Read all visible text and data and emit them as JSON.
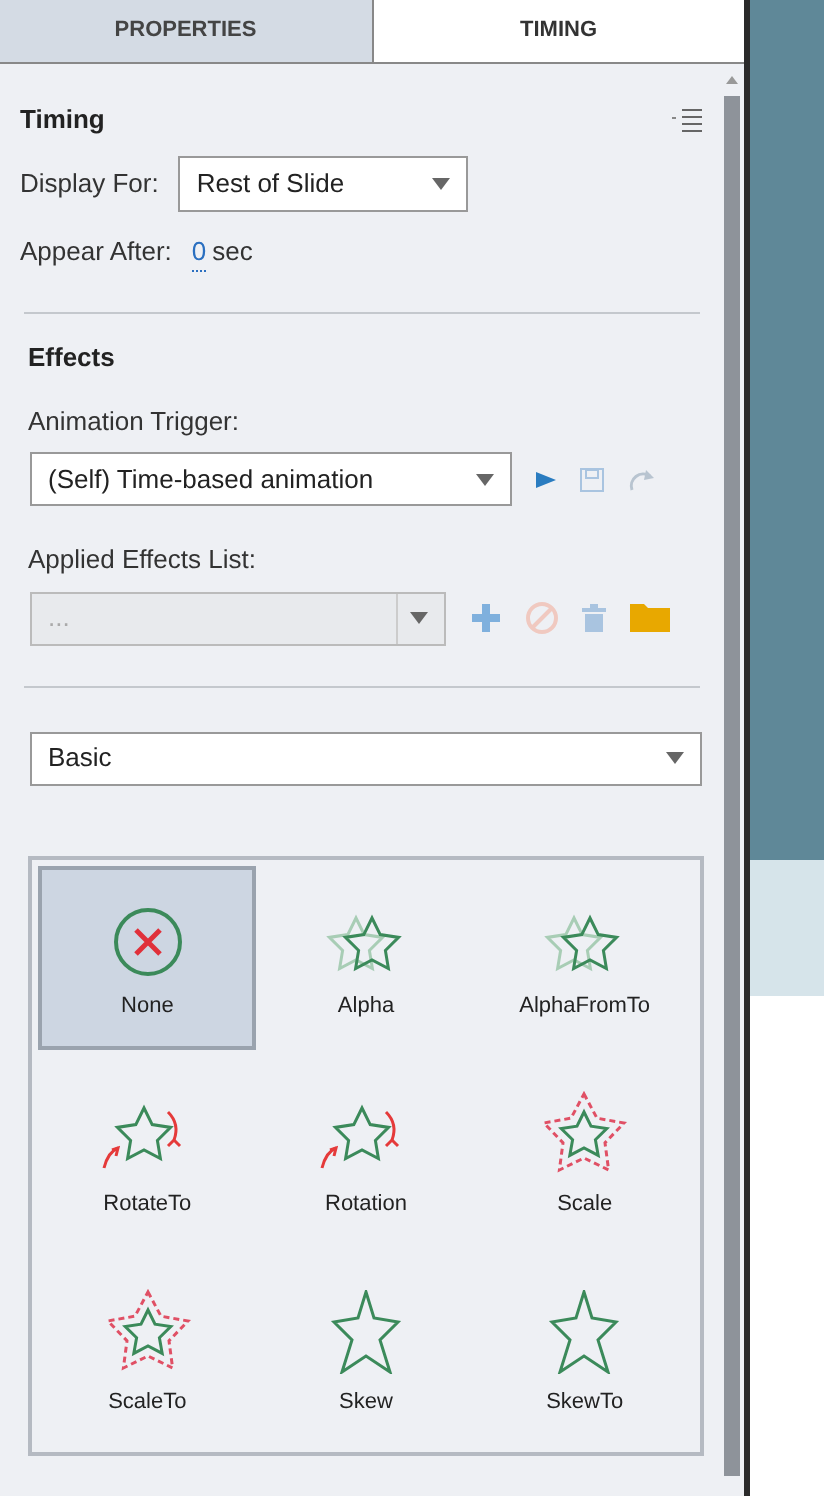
{
  "tabs": [
    {
      "label": "PROPERTIES",
      "selected": false
    },
    {
      "label": "TIMING",
      "selected": true
    }
  ],
  "timing": {
    "title": "Timing",
    "display_for": {
      "label": "Display For:",
      "value": "Rest of Slide"
    },
    "appear_after": {
      "label": "Appear After:",
      "value": "0",
      "unit": "sec"
    }
  },
  "effects": {
    "title": "Effects",
    "trigger": {
      "label": "Animation Trigger:",
      "value": "(Self) Time-based animation"
    },
    "applied": {
      "label": "Applied Effects List:",
      "value": "...",
      "disabled": true
    },
    "category": {
      "value": "Basic"
    }
  },
  "effect_items": [
    {
      "label": "None",
      "kind": "none",
      "selected": true
    },
    {
      "label": "Alpha",
      "kind": "alpha",
      "selected": false
    },
    {
      "label": "AlphaFromTo",
      "kind": "alpha",
      "selected": false
    },
    {
      "label": "RotateTo",
      "kind": "rotate",
      "selected": false
    },
    {
      "label": "Rotation",
      "kind": "rotate",
      "selected": false
    },
    {
      "label": "Scale",
      "kind": "scale",
      "selected": false
    },
    {
      "label": "ScaleTo",
      "kind": "scale",
      "selected": false
    },
    {
      "label": "Skew",
      "kind": "skew",
      "selected": false
    },
    {
      "label": "SkewTo",
      "kind": "skew",
      "selected": false
    }
  ]
}
